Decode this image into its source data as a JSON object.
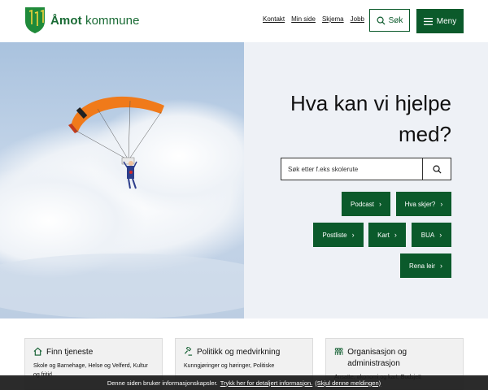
{
  "header": {
    "logo_text_bold": "Åmot",
    "logo_text_rest": " kommune",
    "links": [
      "Kontakt",
      "Min side",
      "Skjema",
      "Jobb"
    ],
    "search_label": "Søk",
    "menu_label": "Meny"
  },
  "hero": {
    "title": "Hva kan vi hjelpe med?",
    "search_placeholder": "Søk etter f.eks skolerute",
    "quick_links": [
      "Podcast",
      "Hva skjer?",
      "Postliste",
      "Kart",
      "BUA",
      "Rena leir"
    ]
  },
  "cards": [
    {
      "title": "Finn tjeneste",
      "desc": "Skole og Barnehage, Helse og Velferd, Kultur og fritid..."
    },
    {
      "title": "Politikk og medvirkning",
      "desc": "Kunngjøringer og høringer, Politiske"
    },
    {
      "title": "Organisasjon og administrasjon",
      "desc": "Ansatte, økonomi og kart, Budsjett"
    }
  ],
  "cookie": {
    "text": "Denne siden bruker informasjonskapsler.",
    "link": "Trykk her for detaljert informasjon.",
    "dismiss": "(Skjul denne meldingen)"
  },
  "colors": {
    "brand_green": "#0b5a2b",
    "hero_panel": "#eef1f6",
    "sky": "#b9cde3"
  }
}
